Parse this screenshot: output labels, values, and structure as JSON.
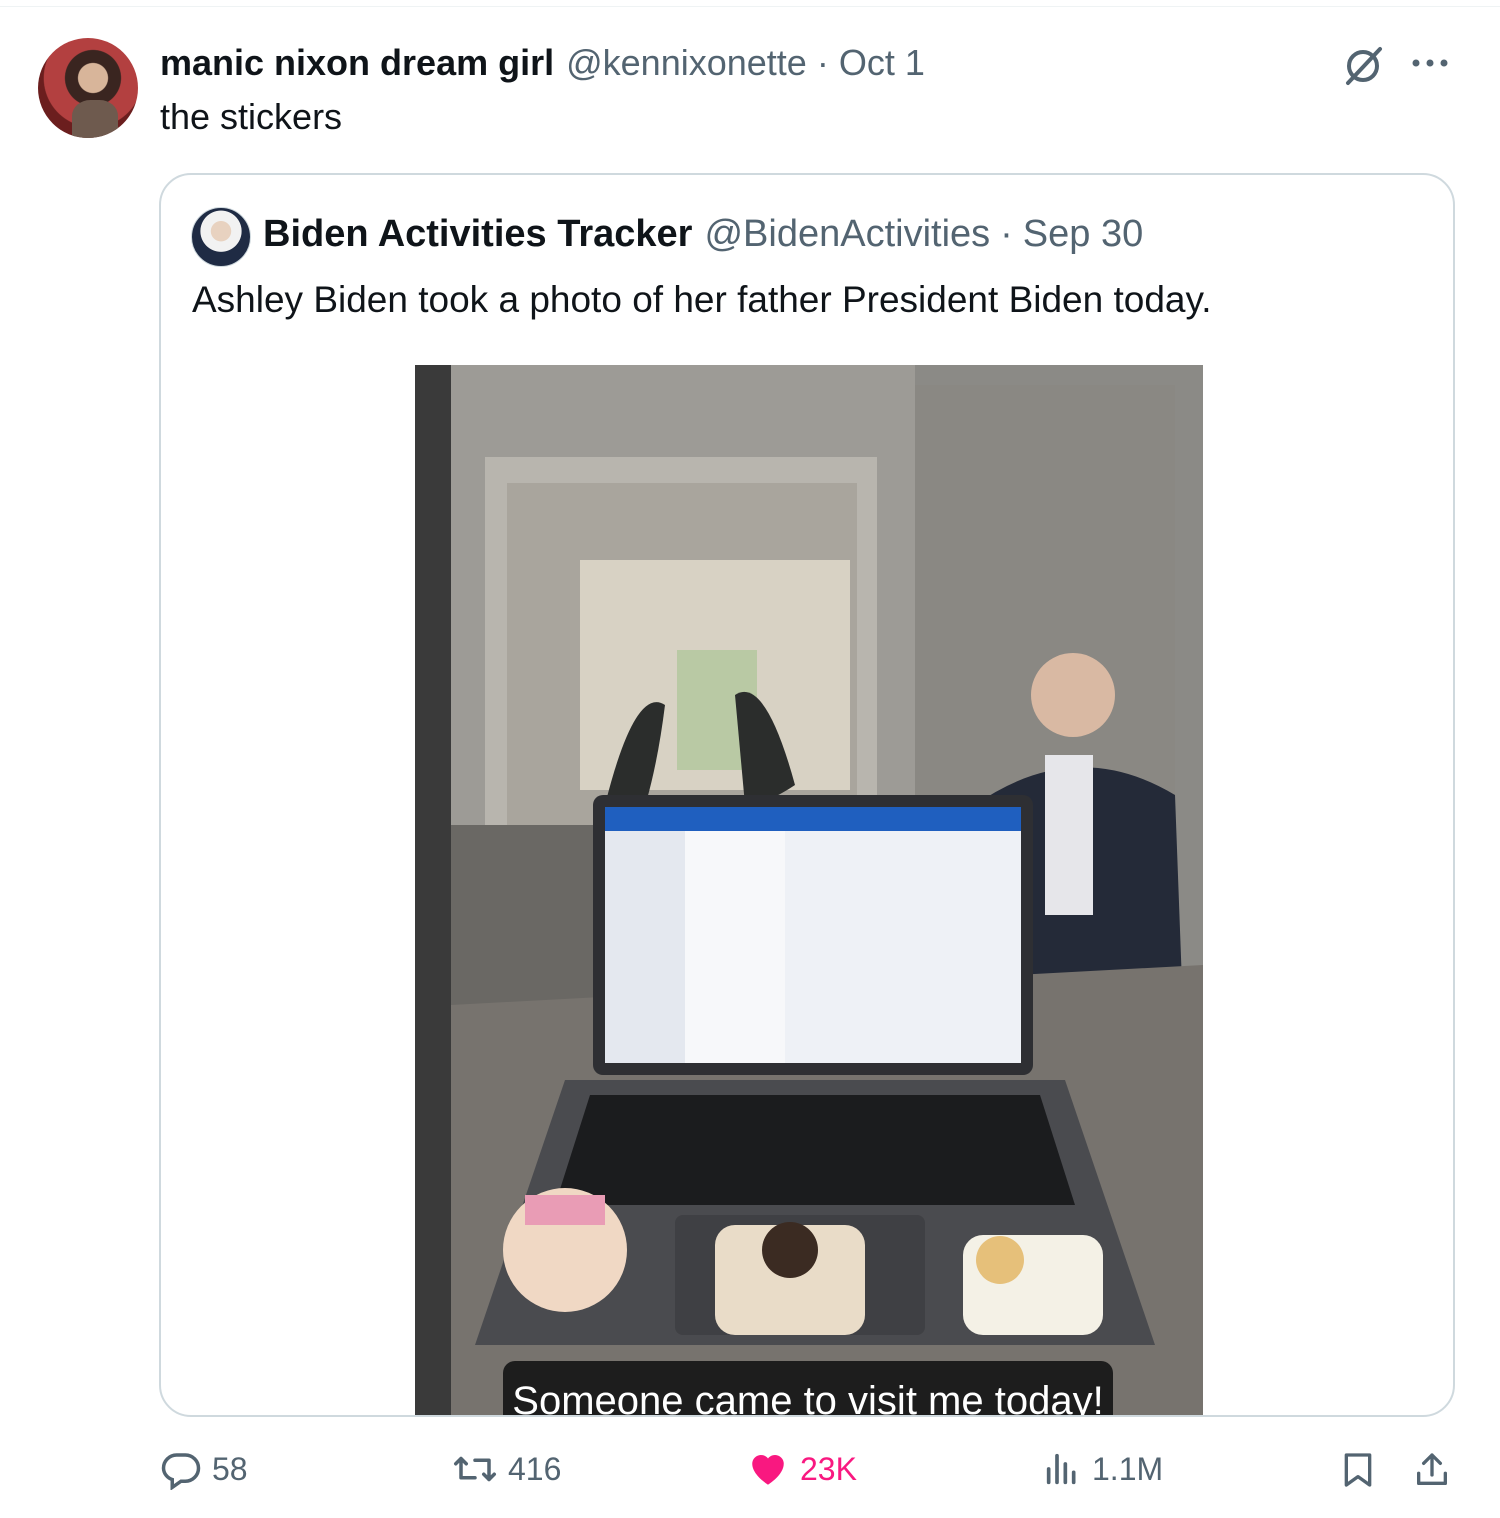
{
  "tweet": {
    "author_name": "manic nixon dream girl",
    "author_handle": "@kennixonette",
    "separator": "·",
    "date": "Oct 1",
    "text": "the stickers"
  },
  "quoted_tweet": {
    "author_name": "Biden Activities Tracker",
    "author_handle": "@BidenActivities",
    "separator": "·",
    "date": "Sep 30",
    "text": "Ashley Biden took a photo of her father President Biden today.",
    "image_caption": "Someone came to visit me today!"
  },
  "actions": {
    "replies": "58",
    "reposts": "416",
    "likes": "23K",
    "views": "1.1M"
  },
  "icons": {
    "header": [
      "grok-icon",
      "more-icon"
    ],
    "actions": [
      "reply-icon",
      "repost-icon",
      "like-icon",
      "views-icon",
      "bookmark-icon",
      "share-icon"
    ]
  },
  "colors": {
    "text_primary": "#0f1419",
    "text_secondary": "#536471",
    "like_pink": "#f91880",
    "border": "#cfd9de"
  }
}
